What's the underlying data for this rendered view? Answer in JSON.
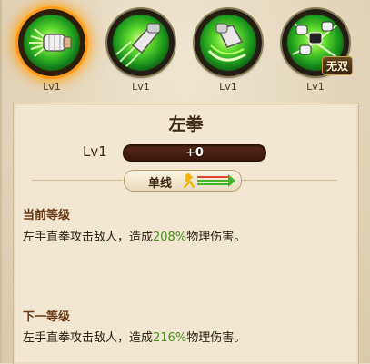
{
  "skills": [
    {
      "name": "left-fist",
      "level": "Lv1",
      "active": true
    },
    {
      "name": "dash-strike",
      "level": "Lv1",
      "active": false
    },
    {
      "name": "sweep",
      "level": "Lv1",
      "active": false
    },
    {
      "name": "wushuang",
      "level": "Lv1",
      "active": false,
      "badge": "无双"
    }
  ],
  "panel": {
    "title": "左拳",
    "level_label": "Lv1",
    "exp_bar_text": "+0",
    "exp_progress": 0,
    "target_tag": "单线",
    "current_header": "当前等级",
    "current_desc_a": "左手直拳攻击敌人，造成",
    "current_pct": "208%",
    "current_desc_b": "物理伤害。",
    "next_header": "下一等级",
    "next_desc_a": "左手直拳攻击敌人，造成",
    "next_pct": "216%",
    "next_desc_b": "物理伤害。"
  },
  "colors": {
    "active_ring": "#ff9a18",
    "percent_green": "#4e8c1c",
    "header_brown": "#6b3a14"
  }
}
